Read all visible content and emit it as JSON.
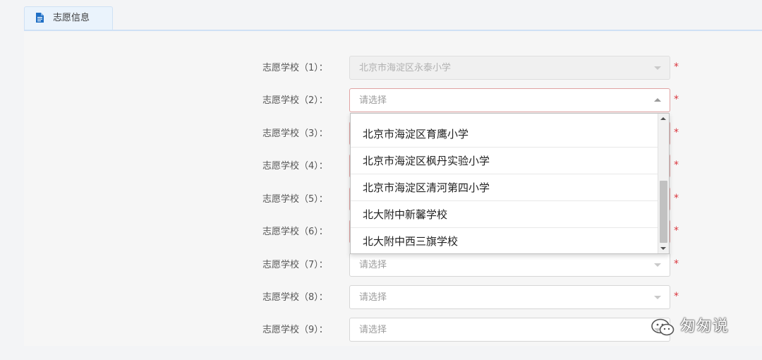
{
  "tab": {
    "label": "志愿信息",
    "icon": "document-icon"
  },
  "fields": [
    {
      "label": "志愿学校（1）：",
      "value": "北京市海淀区永泰小学",
      "required_mark": "*"
    },
    {
      "label": "志愿学校（2）：",
      "value": "请选择",
      "required_mark": "*"
    },
    {
      "label": "志愿学校（3）：",
      "value": "",
      "required_mark": "*"
    },
    {
      "label": "志愿学校（4）：",
      "value": "",
      "required_mark": "*"
    },
    {
      "label": "志愿学校（5）：",
      "value": "",
      "required_mark": "*"
    },
    {
      "label": "志愿学校（6）：",
      "value": "",
      "required_mark": "*"
    },
    {
      "label": "志愿学校（7）：",
      "value": "请选择",
      "required_mark": "*"
    },
    {
      "label": "志愿学校（8）：",
      "value": "请选择",
      "required_mark": "*"
    },
    {
      "label": "志愿学校（9）：",
      "value": "请选择",
      "required_mark": ""
    }
  ],
  "dropdown": {
    "options": [
      "北京市海淀区育鹰小学",
      "北京市海淀区枫丹实验小学",
      "北京市海淀区清河第四小学",
      "北大附中新馨学校",
      "北大附中西三旗学校"
    ]
  },
  "watermark": {
    "text": "匆匆说",
    "icon": "wechat-icon"
  },
  "colors": {
    "required": "#d9363e",
    "tab_bg": "#eaf3fc",
    "tab_border": "#cfe1f5",
    "icon_blue": "#1f6fc5"
  }
}
